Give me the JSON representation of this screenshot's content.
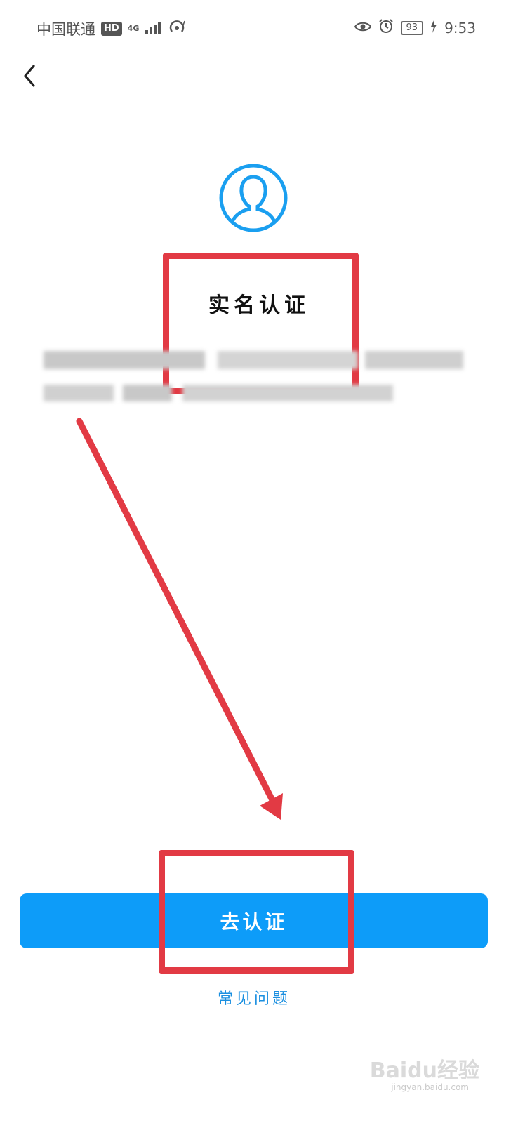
{
  "status_bar": {
    "carrier": "中国联通",
    "hd_badge": "HD",
    "network_type": "4G",
    "battery_level": "93",
    "time": "9:53"
  },
  "page": {
    "title": "实名认证"
  },
  "actions": {
    "primary_button_label": "去认证",
    "faq_link_label": "常见问题"
  },
  "watermark": {
    "brand": "Baidu经验",
    "url": "jingyan.baidu.com"
  },
  "colors": {
    "accent": "#0d9cf9",
    "link": "#1a8fe0",
    "annotation": "#e23a44"
  }
}
